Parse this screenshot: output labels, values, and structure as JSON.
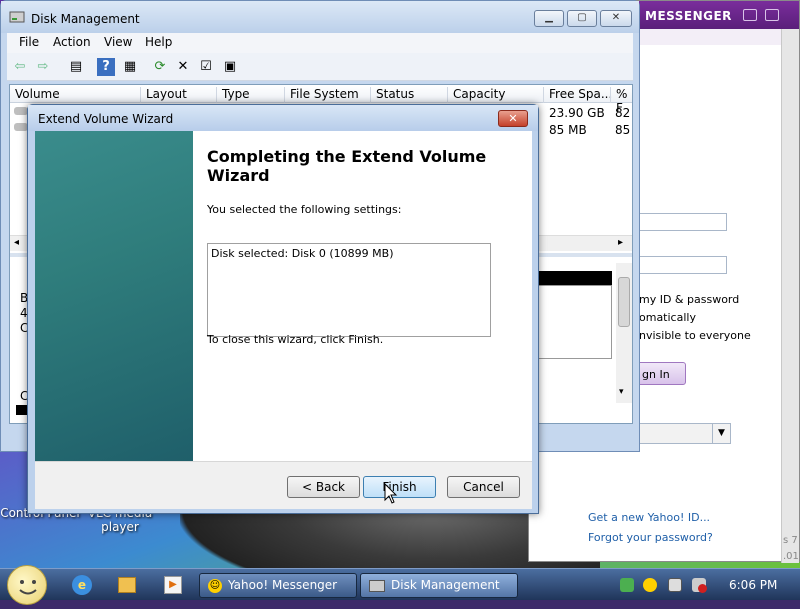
{
  "desktop": {
    "icons": [
      {
        "label": "Control Panel"
      },
      {
        "label": "VLC media player"
      }
    ]
  },
  "yahoo": {
    "title": "MESSENGER",
    "remember": "my ID & password",
    "auto": "omatically",
    "invisible": "nvisible to everyone",
    "signin": "gn In",
    "get_id": "Get a new Yahoo! ID...",
    "forgot": "Forgot your password?",
    "side_text_1": "s 7",
    "side_text_2": ".01"
  },
  "diskmgmt": {
    "title": "Disk Management",
    "menu": [
      "File",
      "Action",
      "View",
      "Help"
    ],
    "columns": [
      "Volume",
      "Layout",
      "Type",
      "File System",
      "Status",
      "Capacity",
      "Free Spa...",
      "% F"
    ],
    "rows": [
      {
        "free": "23.90 GB",
        "pct": "82"
      },
      {
        "free": "85 MB",
        "pct": "85"
      }
    ],
    "lower_letters": [
      "B",
      "4",
      "C",
      "C"
    ]
  },
  "wizard": {
    "title": "Extend Volume Wizard",
    "heading_line1": "Completing the Extend Volume",
    "heading_line2": "Wizard",
    "selected_label": "You selected the following settings:",
    "settings": "Disk selected: Disk 0 (10899 MB)",
    "close_text": "To close this wizard, click Finish.",
    "back": "< Back",
    "finish": "Finish",
    "cancel": "Cancel"
  },
  "taskbar": {
    "items": [
      {
        "label": "Yahoo! Messenger"
      },
      {
        "label": "Disk Management"
      }
    ],
    "clock": "6:06 PM"
  },
  "colors": {
    "wizard_banner": "#2f7d7c",
    "taskbar": "#20355a",
    "yahoo_purple": "#5a1f7a"
  }
}
